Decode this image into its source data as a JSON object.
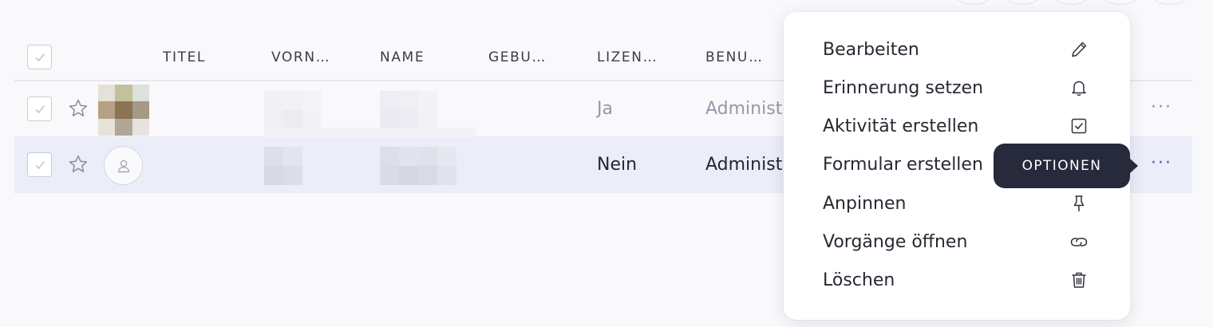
{
  "table": {
    "headers": {
      "titel": "TITEL",
      "vorname": "VORN…",
      "name": "NAME",
      "geburtstag": "GEBU…",
      "lizenz": "LIZEN…",
      "benutzer": "BENU…"
    },
    "rows": [
      {
        "lizenz": "Ja",
        "benutzer": "Administ…",
        "selected": false
      },
      {
        "lizenz": "Nein",
        "benutzer": "Administ…",
        "selected": true
      }
    ],
    "row_menu_label": "···"
  },
  "menu": {
    "items": [
      {
        "label": "Bearbeiten",
        "icon": "pencil-icon"
      },
      {
        "label": "Erinnerung setzen",
        "icon": "bell-icon"
      },
      {
        "label": "Aktivität erstellen",
        "icon": "checkbox-check-icon"
      },
      {
        "label": "Formular erstellen",
        "icon": "form-icon"
      },
      {
        "label": "Anpinnen",
        "icon": "pin-icon"
      },
      {
        "label": "Vorgänge öffnen",
        "icon": "link-icon"
      },
      {
        "label": "Löschen",
        "icon": "trash-icon"
      }
    ]
  },
  "tooltip": {
    "label": "OPTIONEN"
  },
  "colors": {
    "background": "#f9f9fc",
    "selected_row": "#ebedf9",
    "tooltip_bg": "#262a3b",
    "menu_bg": "#ffffff"
  }
}
